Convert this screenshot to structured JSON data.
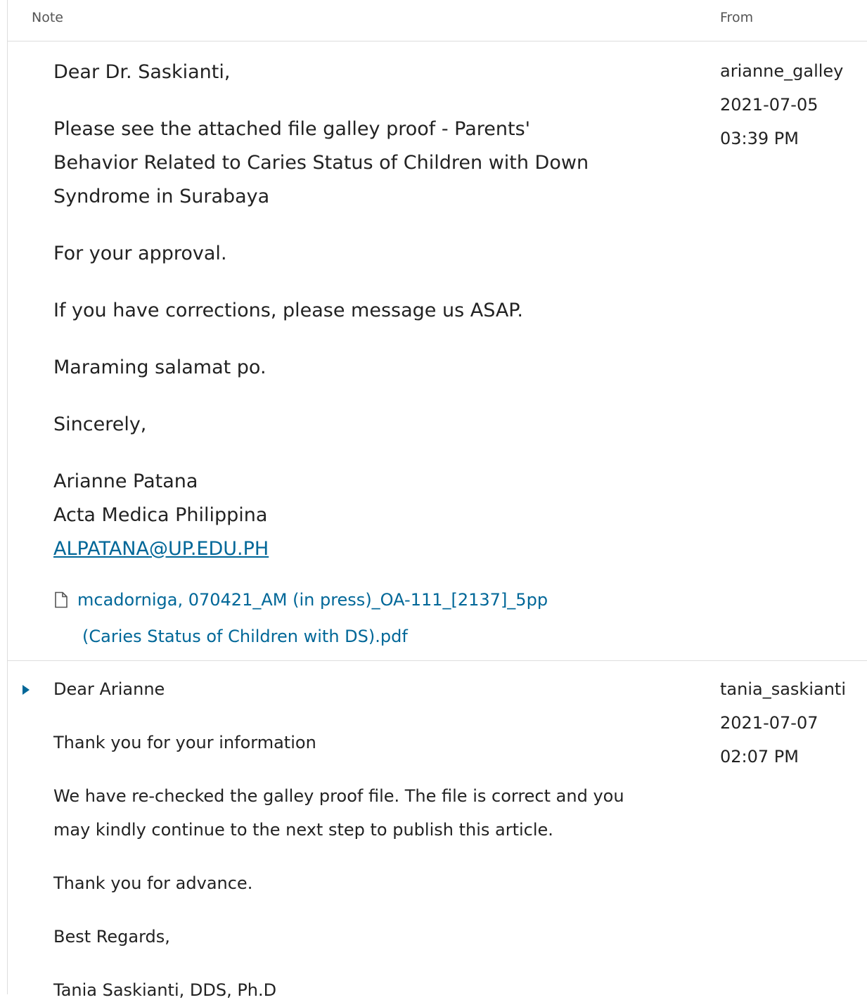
{
  "header": {
    "note_label": "Note",
    "from_label": "From"
  },
  "notes": [
    {
      "greeting": "Dear Dr. Saskianti,",
      "para1_line1": "Please see the attached file galley proof - Parents'",
      "para1_line2": "Behavior Related to Caries Status of Children with Down",
      "para1_line3": "Syndrome in Surabaya",
      "para2": "For your approval.",
      "para3": "If you have corrections, please message us ASAP.",
      "para4": "Maraming salamat po.",
      "closing": "Sincerely,",
      "sig_name": "Arianne Patana",
      "sig_org": "Acta Medica Philippina",
      "sig_email": "ALPATANA@UP.EDU.PH",
      "attachment_line1": "mcadorniga, 070421_AM (in press)_OA-111_[2137]_5pp",
      "attachment_line2": "(Caries Status of Children with DS).pdf",
      "attachment_icon": "file-icon",
      "from_user": "arianne_galley",
      "date": "2021-07-05",
      "time": "03:39 PM"
    },
    {
      "greeting": "Dear Arianne",
      "para1": "Thank you for your information",
      "para2_line1": "We have re-checked the galley proof file. The file is correct and you",
      "para2_line2": "may kindly continue to the next step to publish this article.",
      "para3": "Thank you for advance.",
      "closing": "Best Regards,",
      "sig_partial": "Tania Saskianti, DDS, Ph.D",
      "from_user": "tania_saskianti",
      "date": "2021-07-07",
      "time": "02:07 PM",
      "expand_icon": "caret-right-icon"
    }
  ],
  "colors": {
    "link": "#006798",
    "border": "#dddddd",
    "text": "#222222",
    "header_text": "#555555"
  }
}
